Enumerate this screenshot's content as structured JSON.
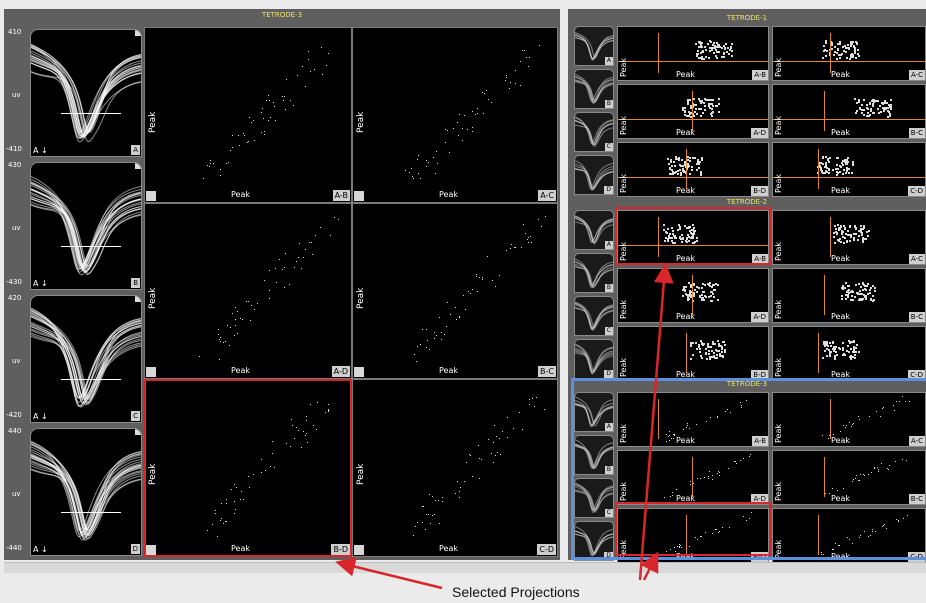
{
  "left_panel": {
    "title": "TETRODE-3",
    "waveforms": [
      {
        "channel": "A",
        "top": "410",
        "mid": "uv",
        "bottom": "-410",
        "arrow": "A ↓"
      },
      {
        "channel": "B",
        "top": "430",
        "mid": "uv",
        "bottom": "-430",
        "arrow": "A ↓"
      },
      {
        "channel": "C",
        "top": "420",
        "mid": "uv",
        "bottom": "-420",
        "arrow": "A ↓"
      },
      {
        "channel": "D",
        "top": "440",
        "mid": "uv",
        "bottom": "-440",
        "arrow": "A ↓"
      }
    ],
    "projections": [
      {
        "label": "A-B",
        "xlabel": "Peak",
        "ylabel": "Peak"
      },
      {
        "label": "A-C",
        "xlabel": "Peak",
        "ylabel": "Peak"
      },
      {
        "label": "A-D",
        "xlabel": "Peak",
        "ylabel": "Peak"
      },
      {
        "label": "B-C",
        "xlabel": "Peak",
        "ylabel": "Peak"
      },
      {
        "label": "B-D",
        "xlabel": "Peak",
        "ylabel": "Peak",
        "selected": true
      },
      {
        "label": "C-D",
        "xlabel": "Peak",
        "ylabel": "Peak"
      }
    ]
  },
  "right_panel": {
    "tetrodes": [
      {
        "title": "TETRODE-1",
        "channels": [
          "A",
          "B",
          "C",
          "D"
        ],
        "projections": [
          "A-B",
          "A-C",
          "A-D",
          "B-C",
          "B-D",
          "C-D"
        ],
        "xlabel": "Peak",
        "ylabel": "Peak"
      },
      {
        "title": "TETRODE-2",
        "channels": [
          "A",
          "B",
          "C",
          "D"
        ],
        "projections": [
          "A-B",
          "A-C",
          "A-D",
          "B-C",
          "B-D",
          "C-D"
        ],
        "xlabel": "Peak",
        "ylabel": "Peak"
      },
      {
        "title": "TETRODE-3",
        "channels": [
          "A",
          "B",
          "C",
          "D"
        ],
        "projections": [
          "A-B",
          "A-C",
          "A-D",
          "B-C",
          "B-D",
          "C-D"
        ],
        "xlabel": "Peak",
        "ylabel": "Peak"
      }
    ]
  },
  "annotation": {
    "caption": "Selected Projections"
  },
  "colors": {
    "panel_bg": "#5f5f5f",
    "plot_bg": "#000000",
    "title_text": "#e6e66a",
    "selection": "#d8262a",
    "active_tetrode": "#5b8fe0",
    "threshold": "#e08a2a"
  }
}
